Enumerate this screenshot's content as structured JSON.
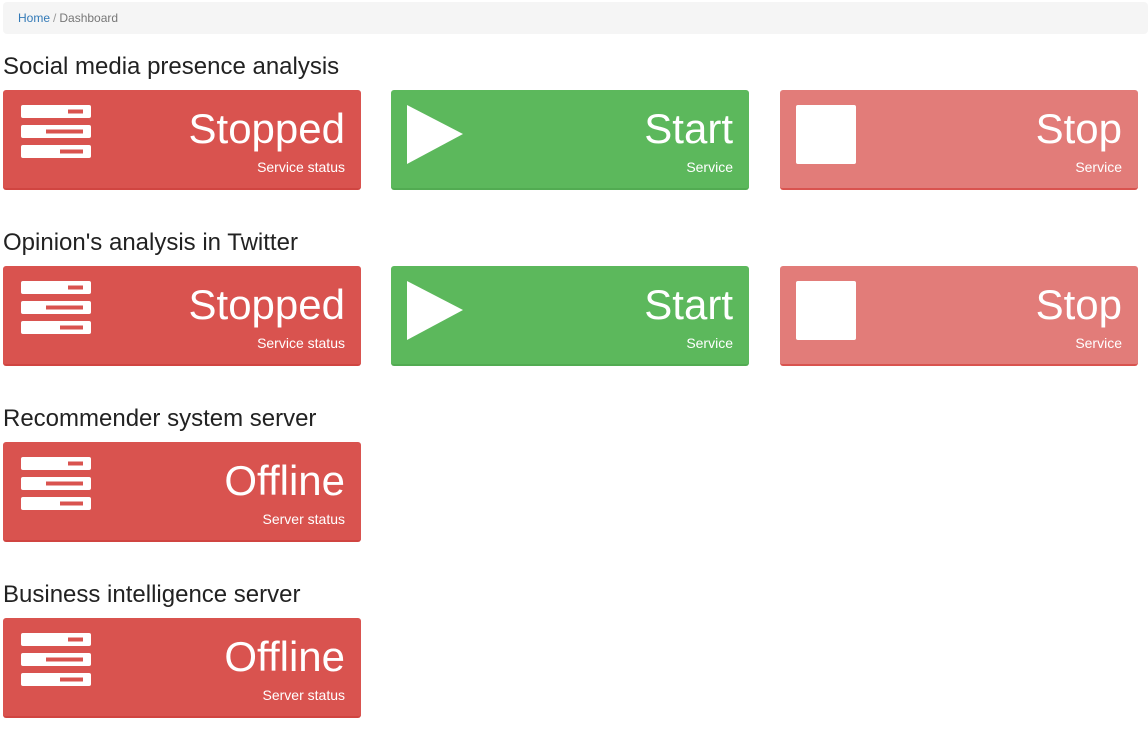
{
  "breadcrumb": {
    "home": "Home",
    "separator": "/",
    "current": "Dashboard"
  },
  "sections": [
    {
      "title": "Social media presence analysis",
      "status": {
        "value": "Stopped",
        "label": "Service status",
        "icon": "server-icon"
      },
      "start": {
        "value": "Start",
        "label": "Service",
        "icon": "play-icon"
      },
      "stop": {
        "value": "Stop",
        "label": "Service",
        "icon": "stop-icon"
      }
    },
    {
      "title": "Opinion's analysis in Twitter",
      "status": {
        "value": "Stopped",
        "label": "Service status",
        "icon": "server-icon"
      },
      "start": {
        "value": "Start",
        "label": "Service",
        "icon": "play-icon"
      },
      "stop": {
        "value": "Stop",
        "label": "Service",
        "icon": "stop-icon"
      }
    },
    {
      "title": "Recommender system server",
      "status": {
        "value": "Offline",
        "label": "Server status",
        "icon": "server-icon"
      }
    },
    {
      "title": "Business intelligence server",
      "status": {
        "value": "Offline",
        "label": "Server status",
        "icon": "server-icon"
      }
    }
  ],
  "colors": {
    "danger": "#d9534f",
    "success": "#5cb85c",
    "danger_light": "#e27c79",
    "link": "#337ab7"
  }
}
